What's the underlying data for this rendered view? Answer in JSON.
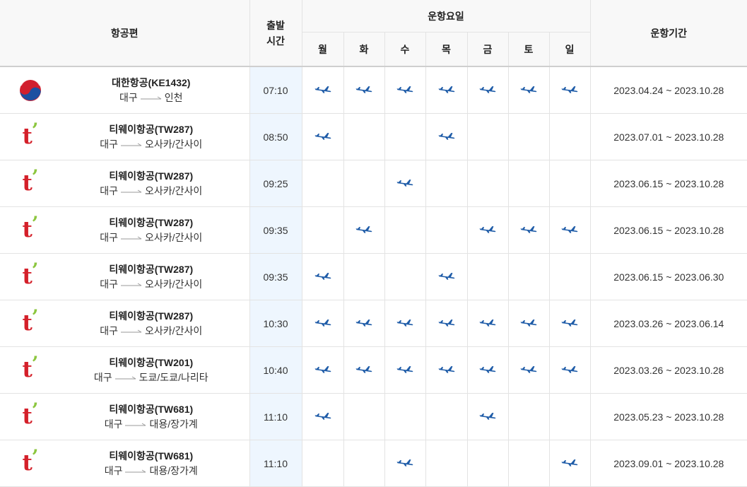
{
  "header": {
    "flight": "항공편",
    "time_line1": "출발",
    "time_line2": "시간",
    "days_group": "운항요일",
    "days": [
      "월",
      "화",
      "수",
      "목",
      "금",
      "토",
      "일"
    ],
    "period": "운항기간"
  },
  "colors": {
    "plane": "#1f5ca8",
    "time_column_bg": "#eef6fe",
    "header_bg": "#f8f8f8",
    "tway_red": "#d4202a",
    "tway_green": "#8cc63f"
  },
  "rows": [
    {
      "airline": "대한항공(KE1432)",
      "logo": "korean-air-logo",
      "from": "대구",
      "to": "인천",
      "time": "07:10",
      "days": [
        1,
        1,
        1,
        1,
        1,
        1,
        1
      ],
      "period": "2023.04.24 ~ 2023.10.28"
    },
    {
      "airline": "티웨이항공(TW287)",
      "logo": "tway-logo",
      "from": "대구",
      "to": "오사카/간사이",
      "time": "08:50",
      "days": [
        1,
        0,
        0,
        1,
        0,
        0,
        0
      ],
      "period": "2023.07.01 ~ 2023.10.28"
    },
    {
      "airline": "티웨이항공(TW287)",
      "logo": "tway-logo",
      "from": "대구",
      "to": "오사카/간사이",
      "time": "09:25",
      "days": [
        0,
        0,
        1,
        0,
        0,
        0,
        0
      ],
      "period": "2023.06.15 ~ 2023.10.28"
    },
    {
      "airline": "티웨이항공(TW287)",
      "logo": "tway-logo",
      "from": "대구",
      "to": "오사카/간사이",
      "time": "09:35",
      "days": [
        0,
        1,
        0,
        0,
        1,
        1,
        1
      ],
      "period": "2023.06.15 ~ 2023.10.28"
    },
    {
      "airline": "티웨이항공(TW287)",
      "logo": "tway-logo",
      "from": "대구",
      "to": "오사카/간사이",
      "time": "09:35",
      "days": [
        1,
        0,
        0,
        1,
        0,
        0,
        0
      ],
      "period": "2023.06.15 ~ 2023.06.30"
    },
    {
      "airline": "티웨이항공(TW287)",
      "logo": "tway-logo",
      "from": "대구",
      "to": "오사카/간사이",
      "time": "10:30",
      "days": [
        1,
        1,
        1,
        1,
        1,
        1,
        1
      ],
      "period": "2023.03.26 ~ 2023.06.14"
    },
    {
      "airline": "티웨이항공(TW201)",
      "logo": "tway-logo",
      "from": "대구",
      "to": "도쿄/도쿄/나리타",
      "time": "10:40",
      "days": [
        1,
        1,
        1,
        1,
        1,
        1,
        1
      ],
      "period": "2023.03.26 ~ 2023.10.28"
    },
    {
      "airline": "티웨이항공(TW681)",
      "logo": "tway-logo",
      "from": "대구",
      "to": "대용/장가계",
      "time": "11:10",
      "days": [
        1,
        0,
        0,
        0,
        1,
        0,
        0
      ],
      "period": "2023.05.23 ~ 2023.10.28"
    },
    {
      "airline": "티웨이항공(TW681)",
      "logo": "tway-logo",
      "from": "대구",
      "to": "대용/장가계",
      "time": "11:10",
      "days": [
        0,
        0,
        1,
        0,
        0,
        0,
        1
      ],
      "period": "2023.09.01 ~ 2023.10.28"
    }
  ]
}
